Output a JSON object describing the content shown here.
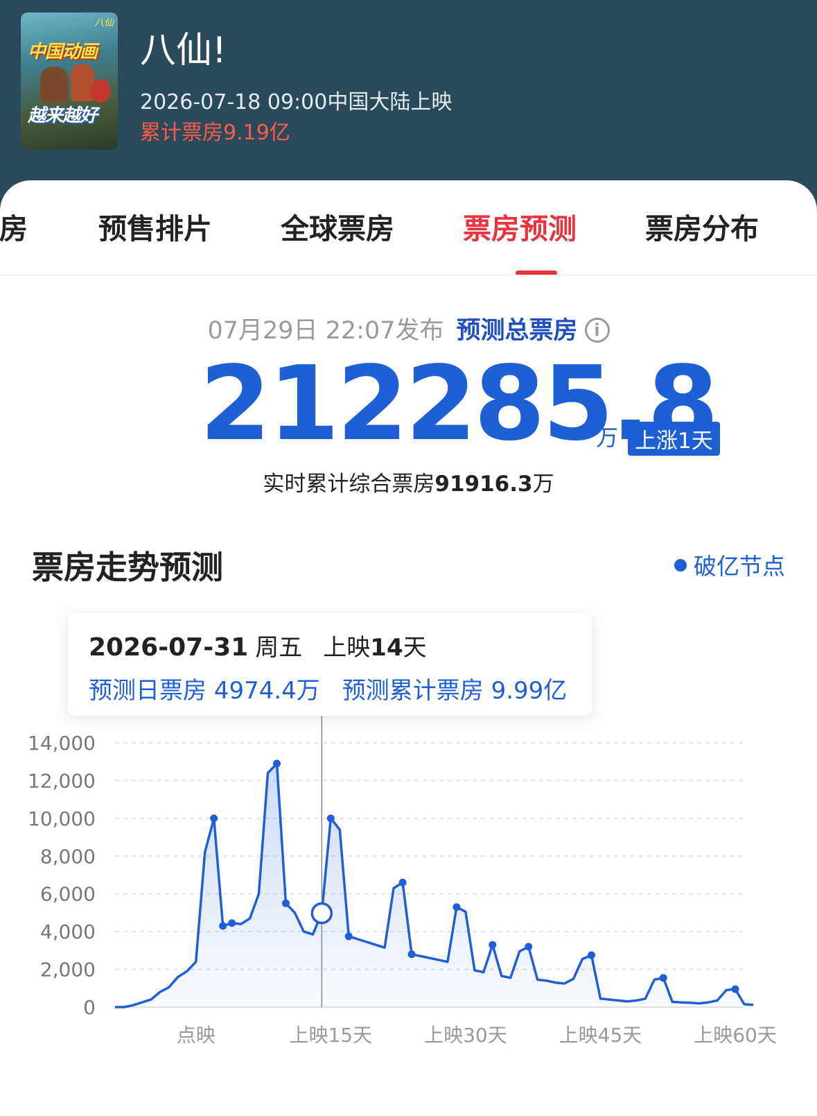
{
  "movie": {
    "title": "八仙!",
    "release": "2026-07-18 09:00中国大陆上映",
    "total_box_office": "累计票房9.19亿",
    "poster": {
      "text_top": "中国动画",
      "text_bottom": "越来越好",
      "tag": "八仙"
    }
  },
  "tabs": [
    {
      "label": "票房"
    },
    {
      "label": "预售排片"
    },
    {
      "label": "全球票房"
    },
    {
      "label": "票房预测",
      "active": true
    },
    {
      "label": "票房分布"
    }
  ],
  "forecast": {
    "publish_time": "07月29日 22:07发布",
    "label": "预测总票房",
    "info_icon": "info-icon",
    "value": "212285.8",
    "unit": "万",
    "badge": "上涨1天",
    "realtime_prefix": "实时累计综合票房",
    "realtime_value": "91916.3",
    "realtime_unit": "万"
  },
  "trend": {
    "title": "票房走势预测",
    "legend": "破亿节点"
  },
  "tooltip": {
    "date": "2026-07-31",
    "weekday": "周五",
    "day_prefix": "上映",
    "day_num": "14",
    "day_suffix": "天",
    "daily": "预测日票房 4974.4万",
    "cumulative": "预测累计票房 9.99亿"
  },
  "colors": {
    "header_bg": "#2a4a5a",
    "accent_red": "#e8343f",
    "accent_blue": "#1f5fd6",
    "line": "#1f5fd6"
  },
  "chart_data": {
    "type": "area",
    "ylim": [
      0,
      14000
    ],
    "yticks": [
      "0",
      "2,000",
      "4,000",
      "6,000",
      "8,000",
      "10,000",
      "12,000",
      "14,000"
    ],
    "ytick_values": [
      0,
      2000,
      4000,
      6000,
      8000,
      10000,
      12000,
      14000
    ],
    "x_labels": [
      {
        "label": "点映",
        "x": 9
      },
      {
        "label": "上映15天",
        "x": 24
      },
      {
        "label": "上映30天",
        "x": 39
      },
      {
        "label": "上映45天",
        "x": 54
      },
      {
        "label": "上映60天",
        "x": 69
      }
    ],
    "x_range": [
      0,
      70
    ],
    "highlight_x": 23,
    "highlight_value": 4974.4,
    "values": [
      0,
      0,
      100,
      250,
      400,
      800,
      1050,
      1600,
      1900,
      2400,
      8200,
      10000,
      4300,
      4450,
      4400,
      4700,
      6000,
      12400,
      12900,
      5500,
      5000,
      4000,
      3850,
      4974.4,
      10000,
      9400,
      3750,
      3600,
      3450,
      3300,
      3150,
      6300,
      6600,
      2800,
      2700,
      2600,
      2500,
      2400,
      5300,
      5050,
      1950,
      1850,
      3300,
      1650,
      1550,
      2950,
      3200,
      1450,
      1400,
      1300,
      1250,
      1500,
      2550,
      2750,
      450,
      400,
      350,
      300,
      350,
      450,
      1450,
      1550,
      280,
      250,
      230,
      200,
      250,
      350,
      900,
      950,
      150,
      120
    ]
  }
}
